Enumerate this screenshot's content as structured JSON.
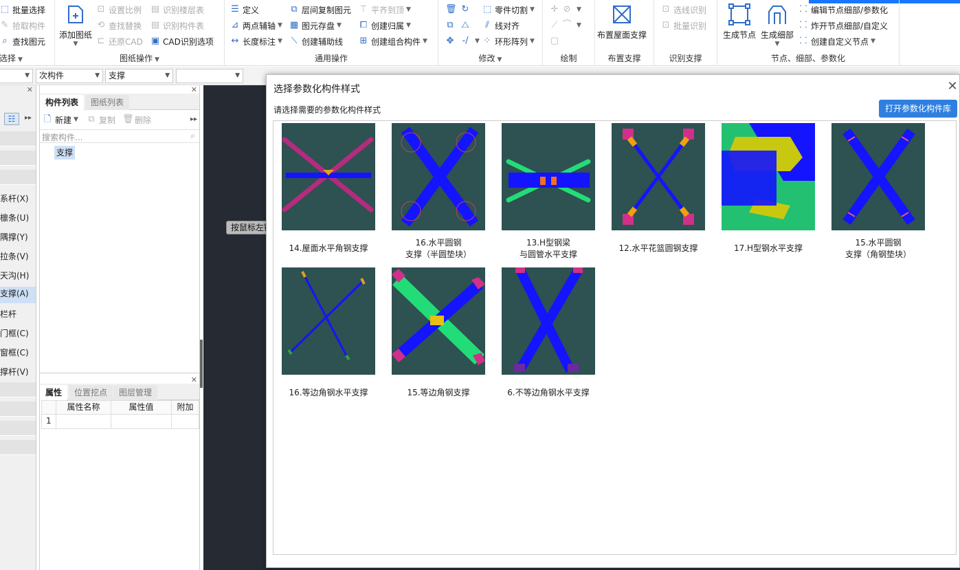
{
  "ribbon": {
    "select_group": {
      "batch_select": "批量选择",
      "pick_component": "拾取构件",
      "find_element": "查找图元",
      "title": "选择"
    },
    "drawing_group": {
      "add_drawing": "添加图纸",
      "set_ratio": "设置比例",
      "find_replace": "查找替换",
      "restore_cad": "还原CAD",
      "identify_floor_table": "识别楼层表",
      "identify_component_table": "识别构件表",
      "cad_identify_options": "CAD识别选项",
      "title": "图纸操作"
    },
    "common_group": {
      "define": "定义",
      "two_point_axis": "两点辅轴",
      "length_dim": "长度标注",
      "copy_between_floors": "层间复制图元",
      "element_save": "图元存盘",
      "create_aux_line": "创建辅助线",
      "align_to_top": "平齐到顶",
      "create_ownership": "创建归属",
      "create_combined": "创建组合构件",
      "title": "通用操作"
    },
    "modify_group": {
      "part_cut": "零件切割",
      "line_align": "线对齐",
      "ring_array": "环形阵列",
      "title": "修改"
    },
    "draw_group": {
      "title": "绘制"
    },
    "layout_group": {
      "layout_roof_brace": "布置屋面支撑",
      "title": "布置支撑"
    },
    "identify_group": {
      "select_line_identify": "选线识别",
      "batch_identify": "批量识别",
      "title": "识别支撑"
    },
    "node_group": {
      "generate_node": "生成节点",
      "generate_detail": "生成细部",
      "edit_node_detail": "编辑节点细部/参数化",
      "explode_node_detail": "炸开节点细部/自定义",
      "create_custom_node": "创建自定义节点",
      "title": "节点、细部、参数化"
    }
  },
  "filters": {
    "sub_component": "次构件",
    "support": "支撑"
  },
  "left_panel": {
    "items": [
      "系杆(X)",
      "檩条(U)",
      "隅撑(Y)",
      "拉条(V)",
      "天沟(H)",
      "支撑(A)",
      "栏杆",
      "门框(C)",
      "窗框(C)",
      "撑杆(V)"
    ]
  },
  "component_panel": {
    "tabs": [
      "构件列表",
      "图纸列表"
    ],
    "new": "新建",
    "copy": "复制",
    "delete": "删除",
    "search_placeholder": "搜索构件...",
    "items": [
      "支撑"
    ]
  },
  "property_panel": {
    "tabs": [
      "属性",
      "位置挖点",
      "图层管理"
    ],
    "headers": [
      "属性名称",
      "属性值",
      "附加"
    ],
    "rows": [
      "1"
    ]
  },
  "canvas": {
    "tooltip": "按鼠标左键"
  },
  "dialog": {
    "title": "选择参数化构件样式",
    "subtitle": "请选择需要的参数化构件样式",
    "open_library": "打开参数化构件库",
    "close": "✕",
    "cards": [
      "14.屋面水平角钢支撑",
      "16.水平圆钢\n支撑（半圆垫块）",
      "13.H型钢梁\n与圆管水平支撑",
      "12.水平花篮圆钢支撑",
      "17.H型钢水平支撑",
      "15.水平圆钢\n支撑（角钢垫块）",
      "16.等边角钢水平支撑",
      "15.等边角钢支撑",
      "6.不等边角钢水平支撑"
    ]
  },
  "colors": {
    "accent": "#2f7fe0",
    "thumb_bg": "#2e5151",
    "steel_blue": "#1414ff",
    "canvas_bg": "#262b33"
  }
}
